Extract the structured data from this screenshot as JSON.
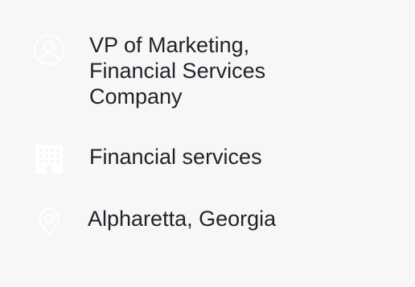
{
  "profile": {
    "title": "VP of Marketing,\nFinancial Services\nCompany",
    "industry": "Financial services",
    "location": "Alpharetta, Georgia"
  },
  "icons": {
    "title": "user-circle-icon",
    "industry": "building-icon",
    "location": "map-pin-icon"
  },
  "colors": {
    "background": "#f7f7f7",
    "text": "#1f2329",
    "icon": "#ffffff"
  }
}
